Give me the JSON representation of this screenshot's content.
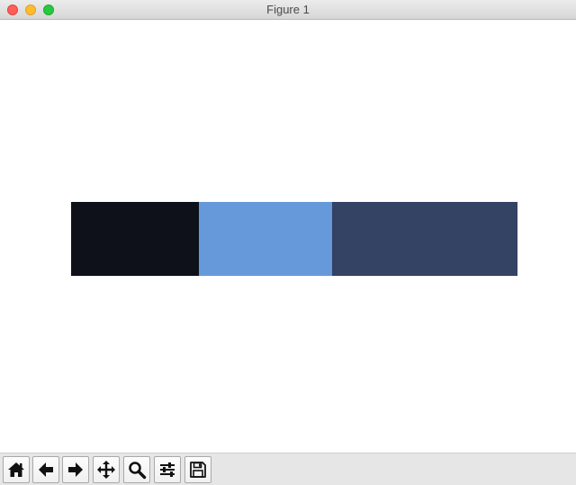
{
  "window": {
    "title": "Figure 1"
  },
  "figure": {
    "colormap_swatches": [
      {
        "color": "#0e1119",
        "fraction": 0.286
      },
      {
        "color": "#6699d9",
        "fraction": 0.298
      },
      {
        "color": "#344264",
        "fraction": 0.416
      }
    ]
  },
  "toolbar": {
    "buttons": [
      {
        "name": "home-button",
        "icon": "home-icon"
      },
      {
        "name": "back-button",
        "icon": "arrow-left-icon"
      },
      {
        "name": "forward-button",
        "icon": "arrow-right-icon"
      },
      {
        "name": "pan-button",
        "icon": "move-icon"
      },
      {
        "name": "zoom-button",
        "icon": "magnifier-icon"
      },
      {
        "name": "configure-subplots-button",
        "icon": "sliders-icon"
      },
      {
        "name": "save-button",
        "icon": "floppy-disk-icon"
      }
    ]
  }
}
